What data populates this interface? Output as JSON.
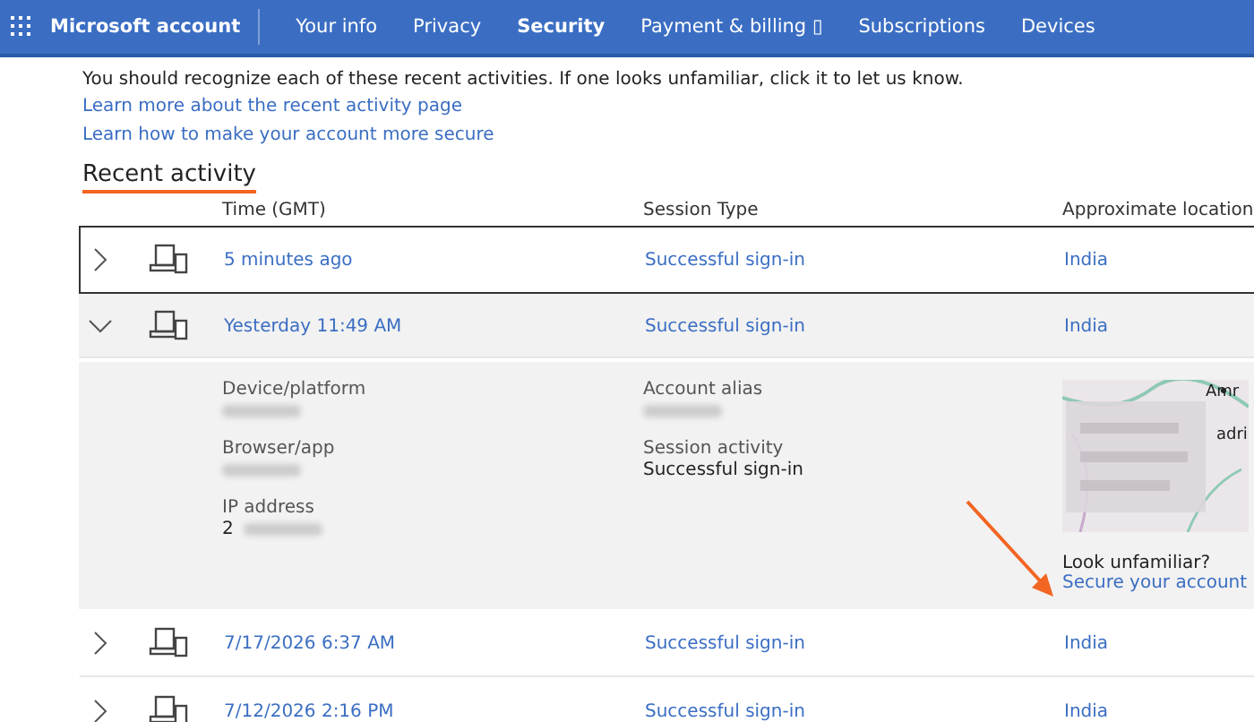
{
  "nav": {
    "brand": "Microsoft account",
    "items": [
      {
        "label": "Your info",
        "selected": false
      },
      {
        "label": "Privacy",
        "selected": false
      },
      {
        "label": "Security",
        "selected": true
      },
      {
        "label": "Payment & billing",
        "selected": false,
        "glyph": "▯"
      },
      {
        "label": "Subscriptions",
        "selected": false
      },
      {
        "label": "Devices",
        "selected": false
      }
    ]
  },
  "intro": "You should recognize each of these recent activities. If one looks unfamiliar, click it to let us know.",
  "links": [
    "Learn more about the recent activity page",
    "Learn how to make your account more secure"
  ],
  "section_title": "Recent activity",
  "columns": [
    "Time (GMT)",
    "Session Type",
    "Approximate location"
  ],
  "rows": [
    {
      "time": "5 minutes ago",
      "session": "Successful sign-in",
      "location": "India",
      "expanded": false,
      "focused": true
    },
    {
      "time": "Yesterday 11:49 AM",
      "session": "Successful sign-in",
      "location": "India",
      "expanded": true,
      "focused": false,
      "details": {
        "left": [
          {
            "label": "Device/platform"
          },
          {
            "label": "Browser/app"
          },
          {
            "label": "IP address",
            "prefix": "2"
          }
        ],
        "right": [
          {
            "label": "Account alias"
          },
          {
            "label": "Session activity",
            "value": "Successful sign-in"
          }
        ],
        "map_labels": [
          "Amr",
          "adri"
        ],
        "prompt": "Look unfamiliar?",
        "action": "Secure your account"
      }
    },
    {
      "time": "7/17/2026 6:37 AM",
      "session": "Successful sign-in",
      "location": "India",
      "expanded": false,
      "focused": false
    },
    {
      "time": "7/12/2026 2:16 PM",
      "session": "Successful sign-in",
      "location": "India",
      "expanded": false,
      "focused": false
    }
  ]
}
